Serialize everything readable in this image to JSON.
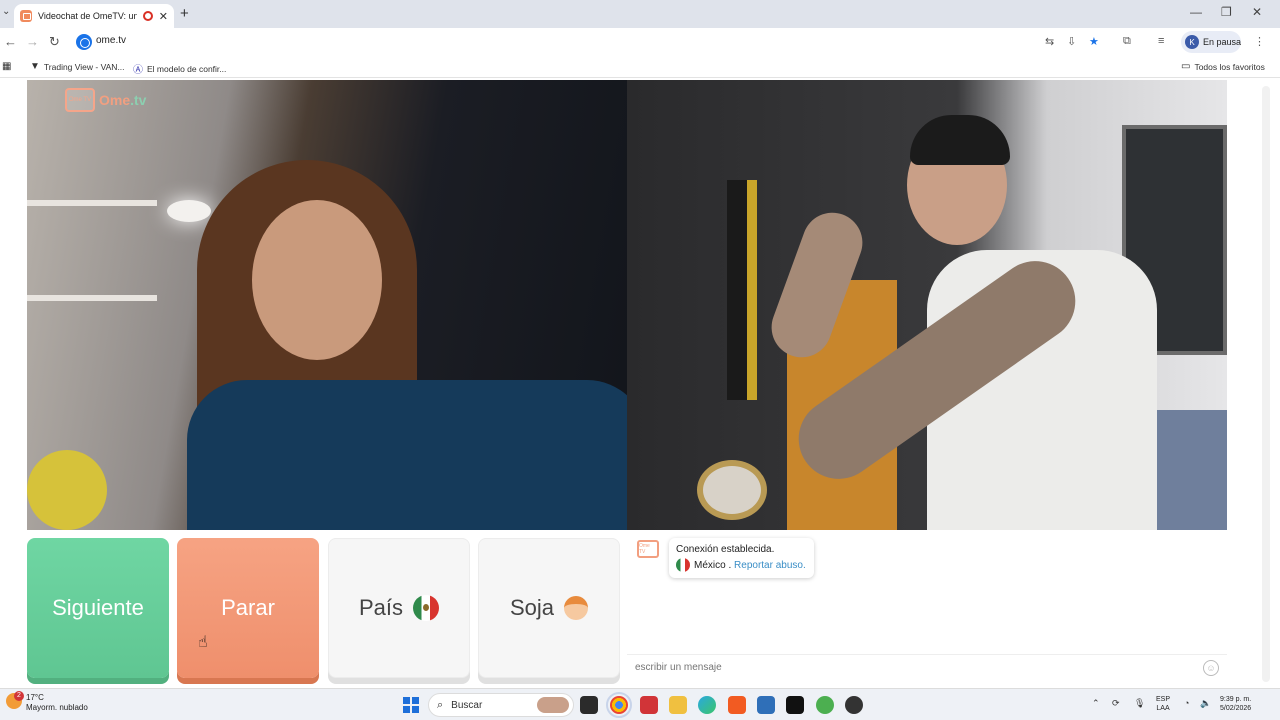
{
  "browser": {
    "tab_title": "Videochat de OmeTV: una ...",
    "tab_close": "✕",
    "new_tab": "+",
    "window_controls": {
      "minimize": "—",
      "maximize": "❐",
      "close": "✕"
    },
    "url": "ome.tv",
    "profile_initial": "K",
    "profile_label": "En pausa"
  },
  "bookmarks": {
    "items": [
      {
        "label": "Trading View - VAN...",
        "icon": "tradingview-icon"
      },
      {
        "label": "El modelo de confir...",
        "icon": "a-logo-icon"
      }
    ],
    "all_favorites": "Todos los favoritos"
  },
  "ome": {
    "logo_top": "Ome TV",
    "logo_main": "Ome",
    "logo_suffix": ".tv",
    "buttons": {
      "next": "Siguiente",
      "stop": "Parar",
      "country": "País",
      "gender": "Soja"
    },
    "chat": {
      "status": "Conexión establecida.",
      "country": "México",
      "separator": " . ",
      "report": "Reportar abuso.",
      "input_placeholder": "escribir un mensaje"
    }
  },
  "taskbar": {
    "weather_badge": "2",
    "temperature": "17°C",
    "weather_desc": "Mayorm. nublado",
    "search_label": "Buscar",
    "lang_top": "ESP",
    "lang_bottom": "LAA",
    "time": "9:39 p. m.",
    "date": "5/02/2026"
  },
  "colors": {
    "next": "#6fd6a3",
    "stop": "#f29f80",
    "report_link": "#3a8ec6"
  }
}
